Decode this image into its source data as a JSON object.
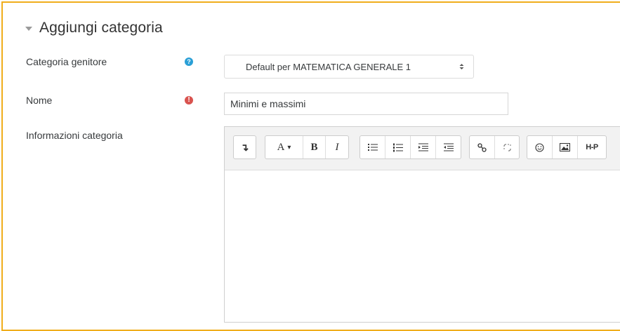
{
  "section": {
    "title": "Aggiungi categoria"
  },
  "fields": {
    "parent": {
      "label": "Categoria genitore",
      "help_glyph": "?",
      "selected": "Default per MATEMATICA GENERALE 1"
    },
    "name": {
      "label": "Nome",
      "required_glyph": "!",
      "value": "Minimi e massimi"
    },
    "info": {
      "label": "Informazioni categoria"
    }
  },
  "toolbar": {
    "collapse_glyph": "↴",
    "font_glyph": "A",
    "font_caret": "▾",
    "bold_glyph": "B",
    "italic_glyph": "I",
    "h5p_label": "H-P"
  },
  "colors": {
    "frame_border": "#f0ad1b",
    "help_icon": "#2a9fd6",
    "required_icon": "#d9534f"
  }
}
